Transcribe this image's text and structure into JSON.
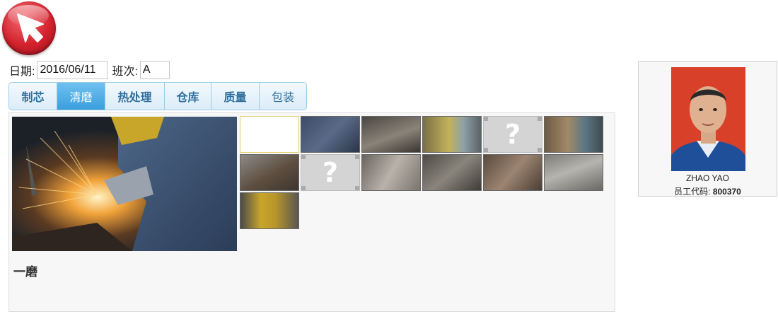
{
  "back_button": {
    "icon": "cursor-arrow-icon",
    "color": "#d3222d"
  },
  "form": {
    "date_label": "日期:",
    "date_value": "2016/06/11",
    "shift_label": "班次:",
    "shift_value": "A"
  },
  "tabs": [
    {
      "label": "制芯",
      "active": false
    },
    {
      "label": "清磨",
      "active": true
    },
    {
      "label": "热处理",
      "active": false
    },
    {
      "label": "仓库",
      "active": false
    },
    {
      "label": "质量",
      "active": false
    },
    {
      "label": "包装",
      "active": false
    }
  ],
  "main": {
    "caption": "一磨",
    "missing_glyph": "?"
  },
  "employee": {
    "name": "ZHAO YAO",
    "code_label": "员工代码:",
    "code_value": "800370"
  },
  "colors": {
    "accent": "#3a9fdc",
    "tab_text": "#2f6f9e",
    "panel_bg": "#f7f7f7"
  }
}
